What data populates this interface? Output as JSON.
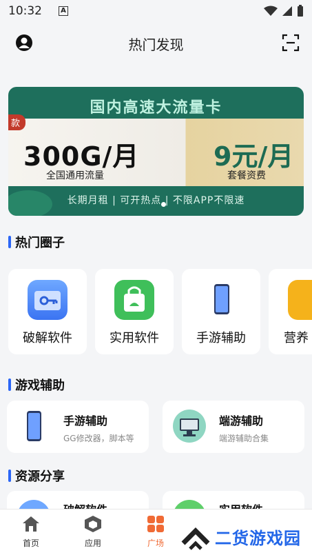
{
  "status": {
    "time": "10:32",
    "notif_badge": "A"
  },
  "header": {
    "title": "热门发现"
  },
  "banner": {
    "headline": "国内高速大流量卡",
    "tag": "款",
    "data_amount": "300G/月",
    "data_sub": "全国通用流量",
    "price": "9元/月",
    "price_sub": "套餐资费",
    "footer": "长期月租 | 可开热点 | 不限APP不限速"
  },
  "sections": {
    "hot_circles": "热门圈子",
    "game_assist": "游戏辅助",
    "resources": "资源分享"
  },
  "circles": [
    {
      "label": "破解软件",
      "icon": "folder-key-icon"
    },
    {
      "label": "实用软件",
      "icon": "shopping-bag-icon"
    },
    {
      "label": "手游辅助",
      "icon": "phone-icon"
    },
    {
      "label": "营养",
      "icon": "yellow-app-icon"
    }
  ],
  "game_cards": [
    {
      "title": "手游辅助",
      "subtitle": "GG修改器，脚本等"
    },
    {
      "title": "端游辅助",
      "subtitle": "端游辅助合集"
    }
  ],
  "resource_cards": [
    {
      "title": "破解软件"
    },
    {
      "title": "实用软件"
    }
  ],
  "tabs": [
    {
      "label": "首页",
      "icon": "home-icon"
    },
    {
      "label": "应用",
      "icon": "cube-icon"
    },
    {
      "label": "广场",
      "icon": "grid-icon"
    }
  ],
  "watermark": "二货游戏园",
  "colors": {
    "accent": "#2b66f6",
    "active_tab": "#f06a35",
    "banner_green": "#1e6f5c"
  }
}
